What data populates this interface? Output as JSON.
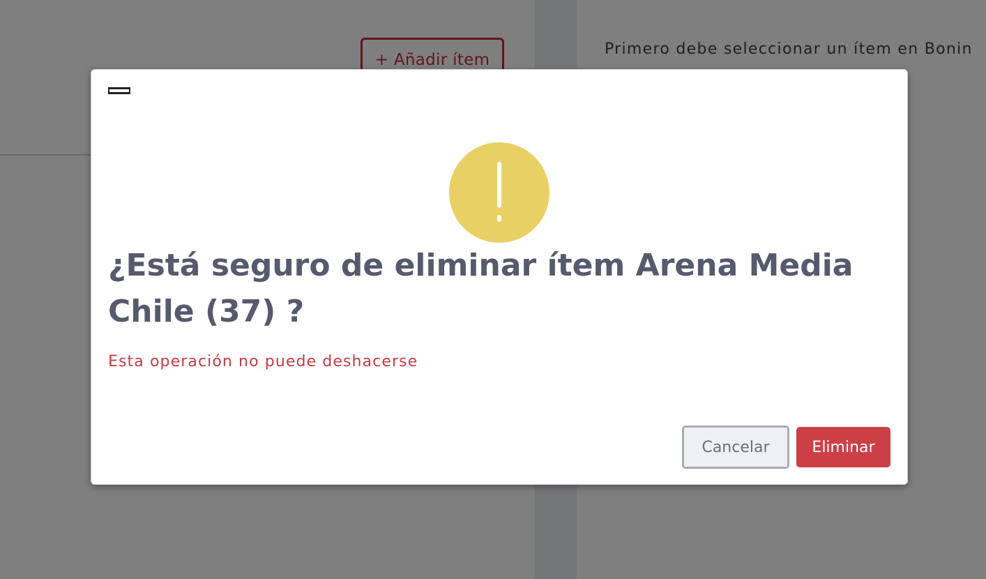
{
  "background": {
    "add_item_label": "+ Añadir ítem",
    "right_hint": "Primero debe seleccionar un ítem en Bonin"
  },
  "modal": {
    "title": "¿Está seguro de eliminar ítem Arena Media Chile (37) ?",
    "warning": "Esta operación no puede deshacerse",
    "icon": "exclamation-icon",
    "cancel_label": "Cancelar",
    "delete_label": "Eliminar"
  },
  "colors": {
    "accent_red": "#cd3f47",
    "warning_yellow": "#e9d064",
    "title_gray": "#565a6d",
    "overlay": "rgba(0,0,0,0.5)"
  }
}
